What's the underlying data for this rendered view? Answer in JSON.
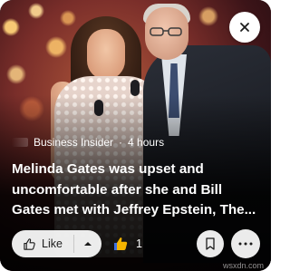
{
  "card": {
    "source_name": "Business Insider",
    "separator": "·",
    "time_ago": "4 hours",
    "headline": "Melinda Gates was upset and uncomfortable after she and Bill Gates met with Jeffrey Epstein, The..."
  },
  "actions": {
    "like_label": "Like",
    "reaction_count": "1"
  },
  "icons": {
    "close": "close-icon",
    "like": "thumbs-up-outline-icon",
    "expand": "chevron-up-icon",
    "reaction": "thumbs-up-emoji-icon",
    "save": "bookmark-icon",
    "more": "more-dots-icon"
  },
  "colors": {
    "overlay_text": "#ffffff",
    "button_bg": "#ffffff",
    "reaction_emoji": "#f5b400"
  },
  "watermark": "wsxdn.com"
}
